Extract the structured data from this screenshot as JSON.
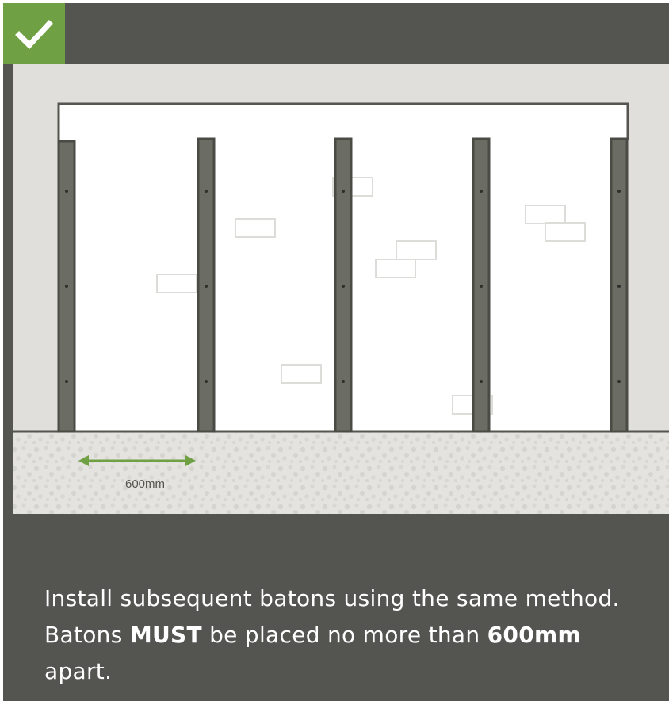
{
  "badge": {
    "icon": "checkmark-icon",
    "color": "#6fa043"
  },
  "diagram": {
    "baton_count": 5,
    "spacing_label": "600mm",
    "arrow_color": "#6fa043",
    "baton_color": "#6b6c64",
    "wall_color": "#e0dfdb",
    "floor_color": "#e4e3df"
  },
  "caption": {
    "part1": "Install subsequent batons using the same method. Batons ",
    "emphasis1": "MUST",
    "part2": " be placed no more than ",
    "emphasis2": "600mm",
    "part3": " apart."
  }
}
